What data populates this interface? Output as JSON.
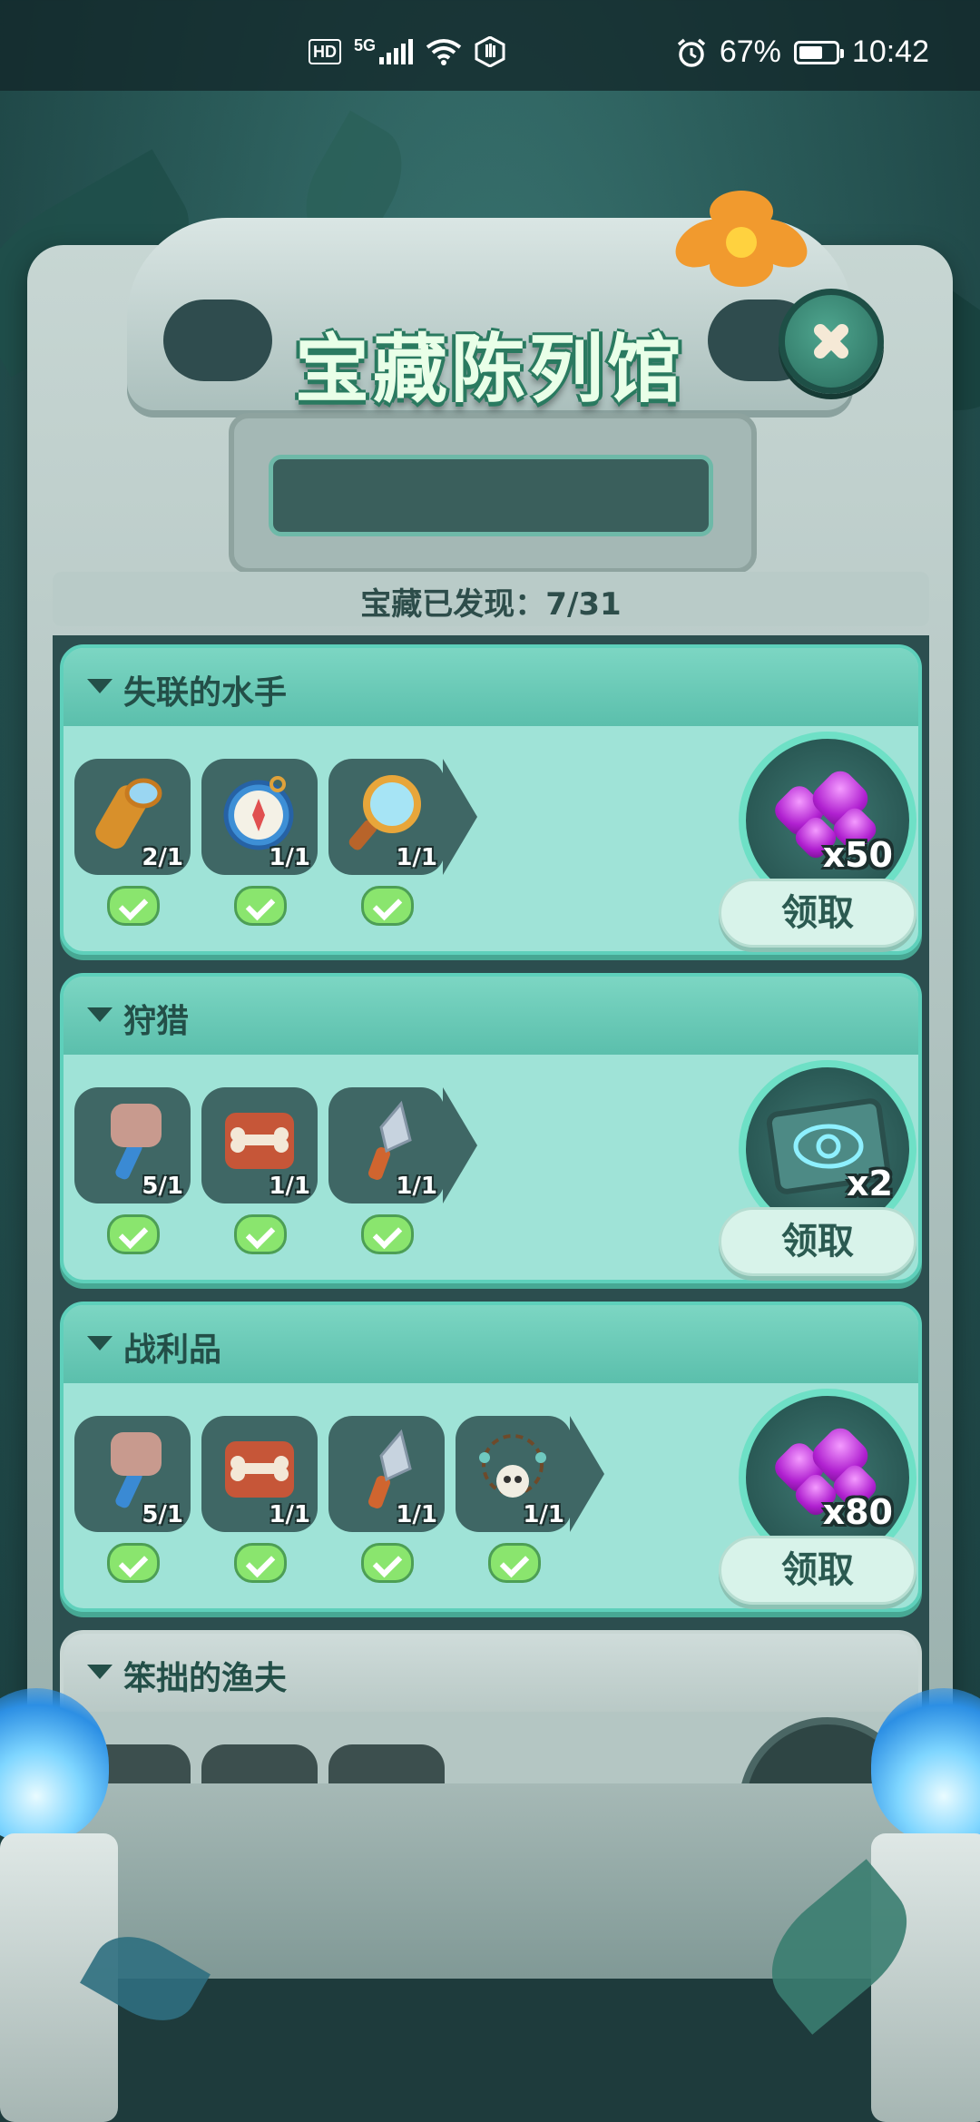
{
  "status_bar": {
    "hd": "HD",
    "network": "5G",
    "battery_percent": "67%",
    "time": "10:42",
    "battery_level": 0.67
  },
  "header": {
    "title": "宝藏陈列馆",
    "progress_label": "宝藏已发现：7/31"
  },
  "cards": [
    {
      "title": "失联的水手",
      "items": [
        {
          "icon": "telescope-icon",
          "count": "2/1",
          "completed": true
        },
        {
          "icon": "compass-icon",
          "count": "1/1",
          "completed": true
        },
        {
          "icon": "magnifier-icon",
          "count": "1/1",
          "completed": true
        }
      ],
      "reward": {
        "icon": "purple-gems-icon",
        "quantity": "x50"
      },
      "claim_label": "领取"
    },
    {
      "title": "狩猎",
      "items": [
        {
          "icon": "stone-hammer-icon",
          "count": "5/1",
          "completed": true
        },
        {
          "icon": "bone-icon",
          "count": "1/1",
          "completed": true
        },
        {
          "icon": "spear-tip-icon",
          "count": "1/1",
          "completed": true
        }
      ],
      "reward": {
        "icon": "eye-ticket-icon",
        "quantity": "x2"
      },
      "claim_label": "领取"
    },
    {
      "title": "战利品",
      "items": [
        {
          "icon": "stone-hammer-icon",
          "count": "5/1",
          "completed": true
        },
        {
          "icon": "bone-icon",
          "count": "1/1",
          "completed": true
        },
        {
          "icon": "spear-tip-icon",
          "count": "1/1",
          "completed": true
        },
        {
          "icon": "skull-necklace-icon",
          "count": "1/1",
          "completed": true
        }
      ],
      "reward": {
        "icon": "purple-gems-icon",
        "quantity": "x80"
      },
      "claim_label": "领取"
    },
    {
      "title": "笨拙的渔夫"
    }
  ],
  "colors": {
    "card_bg": "#9fe3d7",
    "card_border": "#5ed0bb",
    "check_green": "#8ae56e",
    "gem_purple": "#b020d0",
    "title_text": "#e9ffe8"
  }
}
